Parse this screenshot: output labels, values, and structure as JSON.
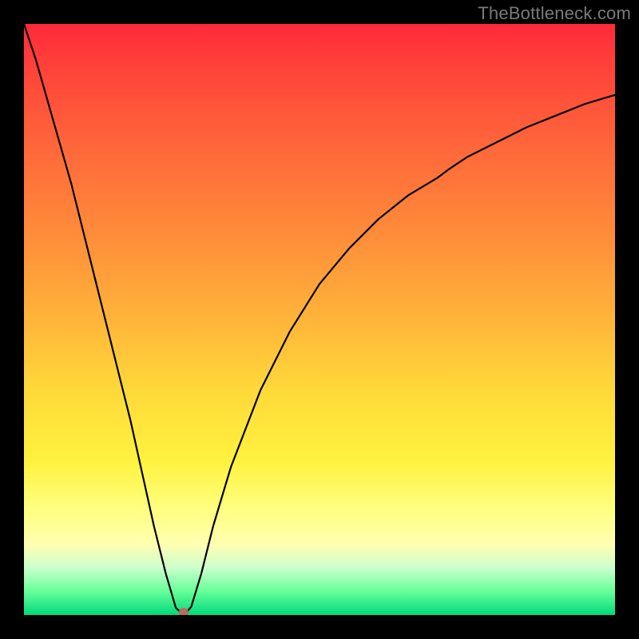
{
  "watermark": "TheBottleneck.com",
  "chart_data": {
    "type": "line",
    "title": "",
    "xlabel": "",
    "ylabel": "",
    "xlim": [
      0,
      100
    ],
    "ylim": [
      0,
      100
    ],
    "series": [
      {
        "name": "bottleneck-curve",
        "x": [
          0,
          2,
          4,
          6,
          8,
          10,
          12,
          14,
          16,
          18,
          20,
          22,
          24,
          25.7,
          26.4,
          27,
          27.6,
          28.3,
          30,
          32,
          35,
          40,
          45,
          50,
          55,
          60,
          65,
          70,
          72,
          75,
          80,
          85,
          90,
          95,
          100
        ],
        "values": [
          100,
          94,
          87,
          80,
          73,
          65,
          57,
          49,
          41,
          33,
          24,
          15,
          7,
          1.2,
          0.6,
          0.4,
          0.6,
          1.4,
          7,
          15,
          25,
          38,
          48,
          56,
          62,
          67,
          71,
          74,
          75.5,
          77.5,
          80,
          82.5,
          84.5,
          86.5,
          88
        ]
      }
    ],
    "marker": {
      "x": 27,
      "y": 0.4,
      "color": "#bb6b58",
      "radius_px": 6
    },
    "background_gradient": {
      "stops": [
        {
          "pct": 0,
          "color": "#ff2a3a"
        },
        {
          "pct": 10,
          "color": "#ff4a3a"
        },
        {
          "pct": 22,
          "color": "#ff6a3a"
        },
        {
          "pct": 36,
          "color": "#ff8d3a"
        },
        {
          "pct": 50,
          "color": "#ffb43a"
        },
        {
          "pct": 62,
          "color": "#ffd93a"
        },
        {
          "pct": 74,
          "color": "#fff23e"
        },
        {
          "pct": 82,
          "color": "#ffff80"
        },
        {
          "pct": 88,
          "color": "#ffffb0"
        },
        {
          "pct": 92,
          "color": "#ccffcc"
        },
        {
          "pct": 96,
          "color": "#66ff99"
        },
        {
          "pct": 100,
          "color": "#00d97a"
        }
      ]
    }
  }
}
